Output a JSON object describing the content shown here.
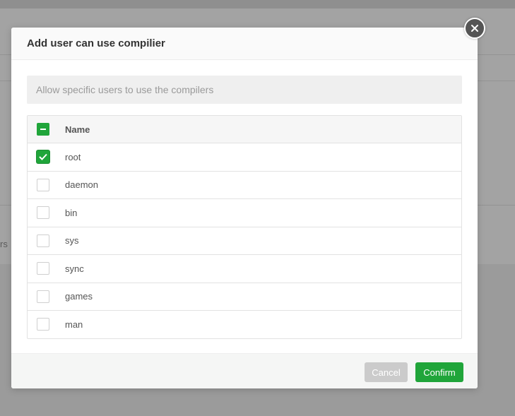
{
  "background": {
    "partial_text": "rs"
  },
  "dialog": {
    "title": "Add user can use compilier",
    "hint": "Allow specific users to use the compilers",
    "table": {
      "header": "Name",
      "rows": [
        {
          "name": "root",
          "checked": true
        },
        {
          "name": "daemon",
          "checked": false
        },
        {
          "name": "bin",
          "checked": false
        },
        {
          "name": "sys",
          "checked": false
        },
        {
          "name": "sync",
          "checked": false
        },
        {
          "name": "games",
          "checked": false
        },
        {
          "name": "man",
          "checked": false
        }
      ]
    },
    "buttons": {
      "cancel": "Cancel",
      "confirm": "Confirm"
    }
  },
  "colors": {
    "accent": "#20a53a",
    "overlay": "#9b9b9b",
    "cancel": "#cbcbcb"
  },
  "icons": {
    "close": "close-icon",
    "check": "checkmark-icon",
    "partial": "minus-icon"
  }
}
